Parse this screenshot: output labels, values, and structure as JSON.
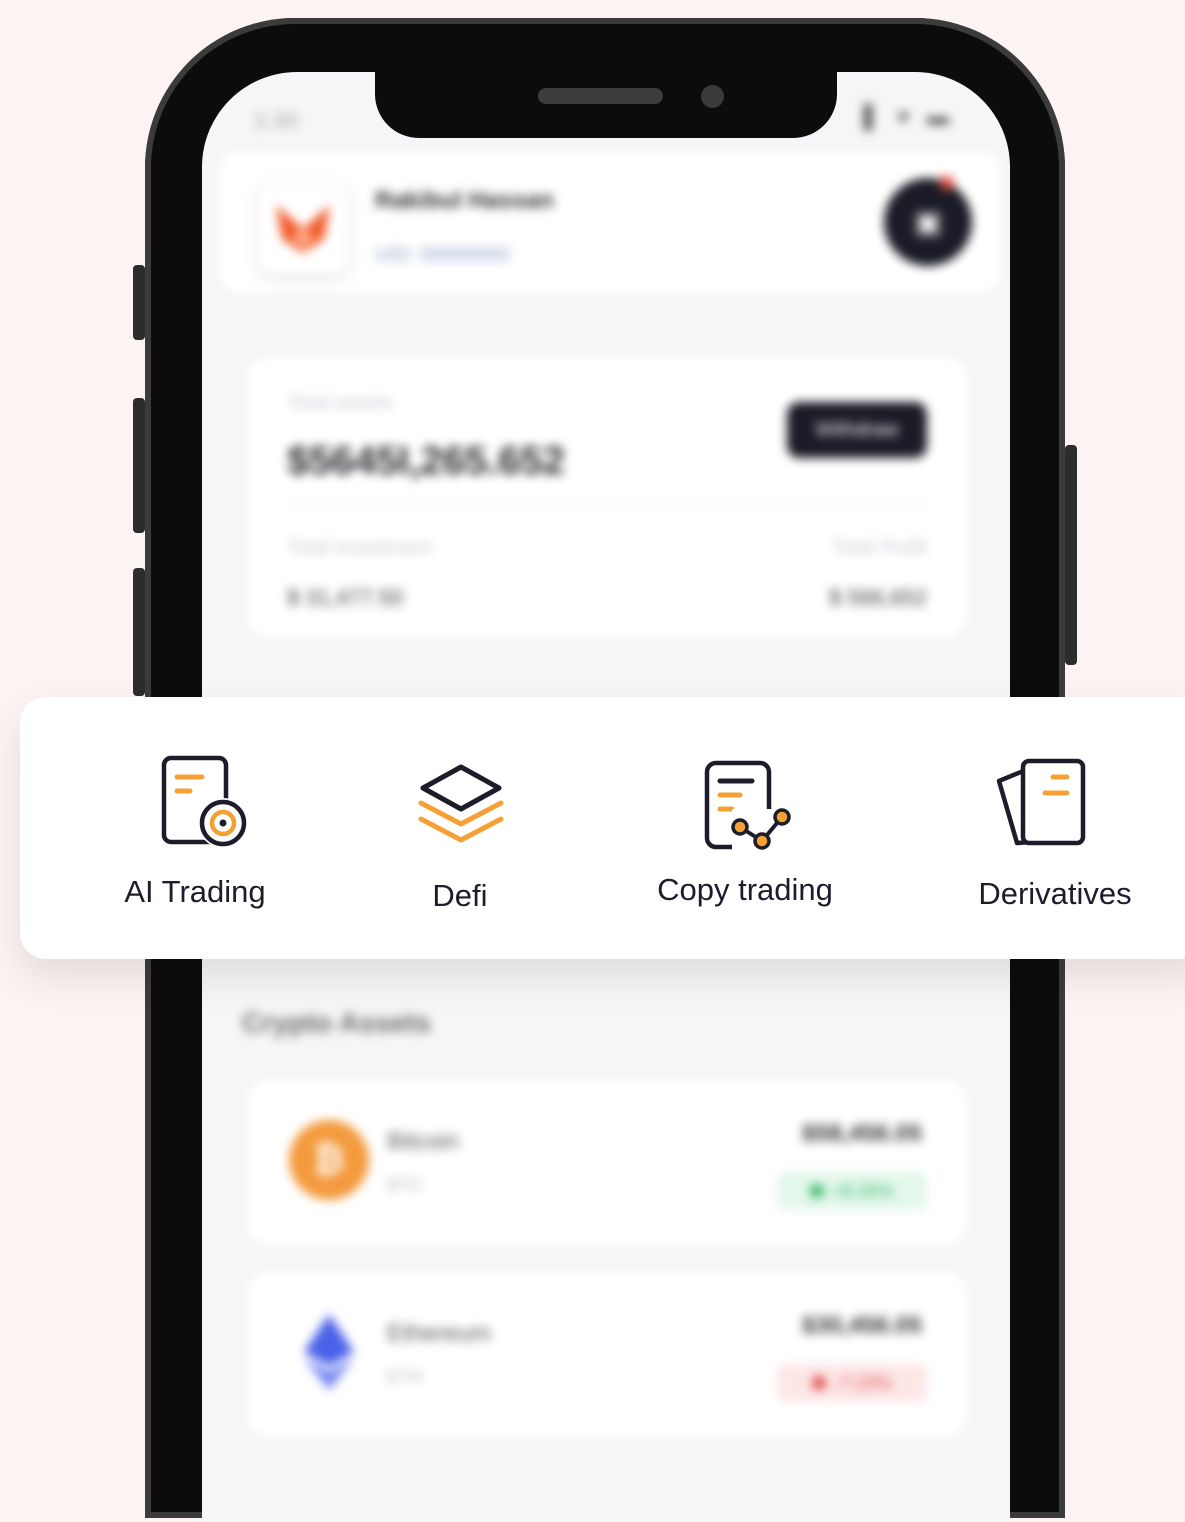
{
  "status_bar": {
    "time": "1:30",
    "icons": "▌ ▾ ▬"
  },
  "profile": {
    "name": "Rakibul Hassan",
    "uid": "UID: 00000000"
  },
  "assets": {
    "total_label": "Total assets",
    "total_value": "$5645I,265.652",
    "withdraw_label": "Withdraw",
    "investment_label": "Total investment",
    "investment_value": "$ 31,477.50",
    "profit_label": "Total Profit",
    "profit_value": "$ 566,652"
  },
  "features": [
    {
      "label": "AI Trading",
      "icon": "ai-trading-icon"
    },
    {
      "label": "Defi",
      "icon": "defi-layers-icon"
    },
    {
      "label": "Copy trading",
      "icon": "copy-trading-icon"
    },
    {
      "label": "Derivatives",
      "icon": "derivatives-icon"
    }
  ],
  "crypto_assets": {
    "title": "Crypto Assets",
    "items": [
      {
        "name": "Bitcoin",
        "symbol": "BTC",
        "price": "$58,456.05",
        "change": "+8.26%",
        "color": "#f39a3d",
        "trend": "up"
      },
      {
        "name": "Ethereum",
        "symbol": "ETH",
        "price": "$30,456.05",
        "change": "-7.23%",
        "color": "#4b62e8",
        "trend": "down"
      }
    ]
  },
  "colors": {
    "accent": "#f4a035",
    "dark": "#1c1c2b",
    "background": "#fcf4f2"
  }
}
